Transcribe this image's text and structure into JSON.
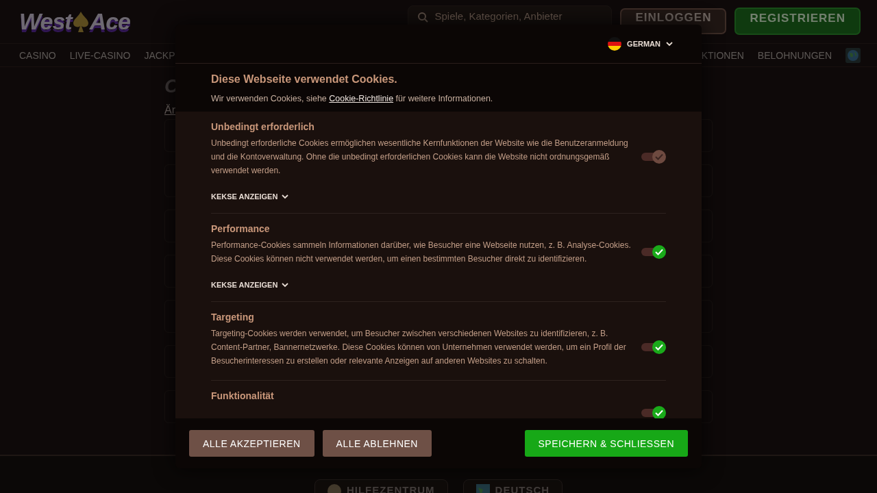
{
  "header": {
    "logo": {
      "left": "West",
      "right": "Ace"
    },
    "search": {
      "placeholder": "Spiele, Kategorien, Anbieter"
    },
    "login_button": "EINLOGGEN",
    "register_button": "REGISTRIEREN"
  },
  "nav": {
    "left": [
      "CASINO",
      "LIVE-CASINO",
      "JACKP"
    ],
    "right": [
      "KTIONEN",
      "BELOHNUNGEN"
    ]
  },
  "content": {
    "heading": "C",
    "link": "Är"
  },
  "footer": {
    "buttons": [
      "HILFEZENTRUM",
      "DEUTSCH"
    ]
  },
  "cookie_dialog": {
    "language": "GERMAN",
    "title": "Diese Webseite verwendet Cookies.",
    "intro_before": "Wir verwenden Cookies, siehe ",
    "intro_link": "Cookie-Richtlinie",
    "intro_after": " für weitere Informationen.",
    "sections": [
      {
        "title": "Unbedingt erforderlich",
        "description": "Unbedingt erforderliche Cookies ermöglichen wesentliche Kernfunktionen der Website wie die Benutzeranmeldung und die Kontoverwaltung. Ohne die unbedingt erforderlichen Cookies kann die Website nicht ordnungsgemäß verwendet werden.",
        "toggle": {
          "on": true,
          "disabled": true
        },
        "details_link": "KEKSE ANZEIGEN"
      },
      {
        "title": "Performance",
        "description": "Performance-Cookies sammeln Informationen darüber, wie Besucher eine Webseite nutzen, z. B. Analyse-Cookies. Diese Cookies können nicht verwendet werden, um einen bestimmten Besucher direkt zu identifizieren.",
        "toggle": {
          "on": true,
          "disabled": false
        },
        "details_link": "KEKSE ANZEIGEN"
      },
      {
        "title": "Targeting",
        "description": "Targeting-Cookies werden verwendet, um Besucher zwischen verschiedenen Websites zu identifizieren, z. B. Content-Partner, Bannernetzwerke. Diese Cookies können von Unternehmen verwendet werden, um ein Profil der Besucherinteressen zu erstellen oder relevante Anzeigen auf anderen Websites zu schalten.",
        "toggle": {
          "on": true,
          "disabled": false
        }
      },
      {
        "title": "Funktionalität",
        "toggle": {
          "on": true,
          "disabled": false
        }
      }
    ],
    "buttons": [
      {
        "label": "ALLE AKZEPTIEREN",
        "kind": "secondary"
      },
      {
        "label": "ALLE ABLEHNEN",
        "kind": "secondary"
      },
      {
        "label": "SPEICHERN & SCHLIESSEN",
        "kind": "primary"
      }
    ]
  }
}
